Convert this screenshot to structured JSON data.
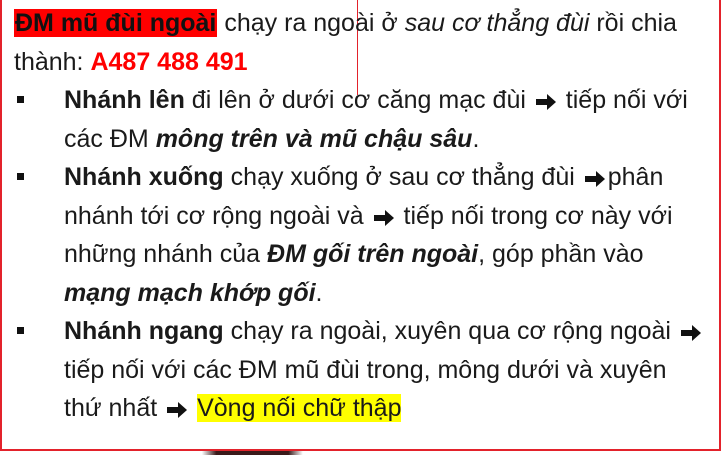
{
  "intro": {
    "highlight": "ĐM mũ đùi ngoài",
    "t1": " chạy ra ngoài ở ",
    "t2_italic": "sau cơ thẳng đùi",
    "t3": " rồi chia thành: ",
    "code": "A487 488 491"
  },
  "bullets": [
    {
      "bold": "Nhánh lên",
      "t1": " đi lên ở dưới cơ căng mạc đùi ",
      "t2": " tiếp nối với các ĐM ",
      "bold_italic": "mông trên và mũ chậu sâu",
      "t3": "."
    },
    {
      "bold": "Nhánh xuống",
      "t1": " chạy xuống ở sau cơ thẳng đùi ",
      "t2": "phân nhánh tới cơ rộng ngoài và ",
      "t3": " tiếp nối trong cơ này với những nhánh của ",
      "bold_italic1": "ĐM gối trên ngoài",
      "t4": ", góp phần vào ",
      "bold_italic2": "mạng mạch khớp gối",
      "t5": "."
    },
    {
      "bold": "Nhánh ngang",
      "t1": " chạy ra ngoài, xuyên qua cơ rộng ngoài ",
      "t2": " tiếp nối với các ĐM mũ đùi trong, mông dưới và xuyên thứ nhất ",
      "highlight": "Vòng nối chữ thập"
    }
  ],
  "colors": {
    "accent_red": "#ff0000",
    "highlight_yellow": "#ffff00",
    "frame_red": "#e3222b"
  },
  "icons": {
    "bullet": "square-bullet-icon",
    "arrow": "right-arrow-icon"
  }
}
